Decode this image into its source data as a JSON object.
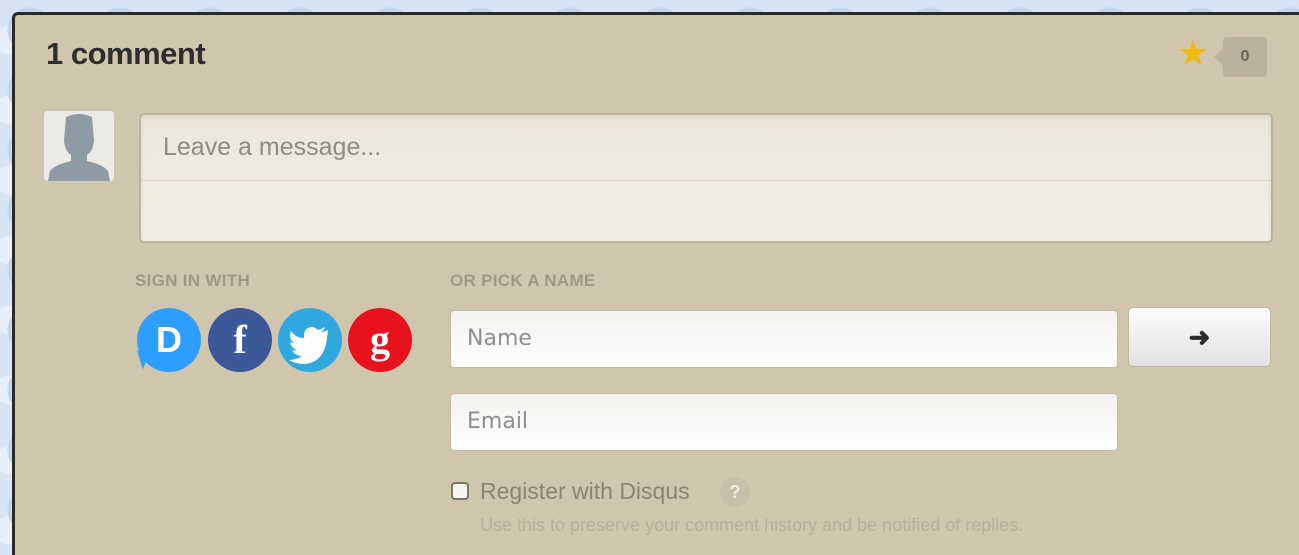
{
  "header": {
    "title": "1 comment",
    "star_icon": "star-icon",
    "like_count": "0"
  },
  "composer": {
    "placeholder": "Leave a message..."
  },
  "sign_in": {
    "label": "SIGN IN WITH",
    "providers": [
      {
        "name": "Disqus",
        "glyph": "D",
        "color": "#2e9fff"
      },
      {
        "name": "Facebook",
        "glyph": "f",
        "color": "#3b5998"
      },
      {
        "name": "Twitter",
        "glyph": "twitter-bird",
        "color": "#2fa8e0"
      },
      {
        "name": "Google",
        "glyph": "g",
        "color": "#e8121e"
      }
    ]
  },
  "guest": {
    "label": "OR PICK A NAME",
    "name_placeholder": "Name",
    "email_placeholder": "Email",
    "submit_icon": "arrow-right-icon",
    "register_label": "Register with Disqus",
    "help_label": "?",
    "register_hint": "Use this to preserve your comment history and be notified of replies."
  },
  "colors": {
    "panel": "#d0c6ae",
    "star": "#f2b812",
    "background": "#d8e4f4"
  }
}
